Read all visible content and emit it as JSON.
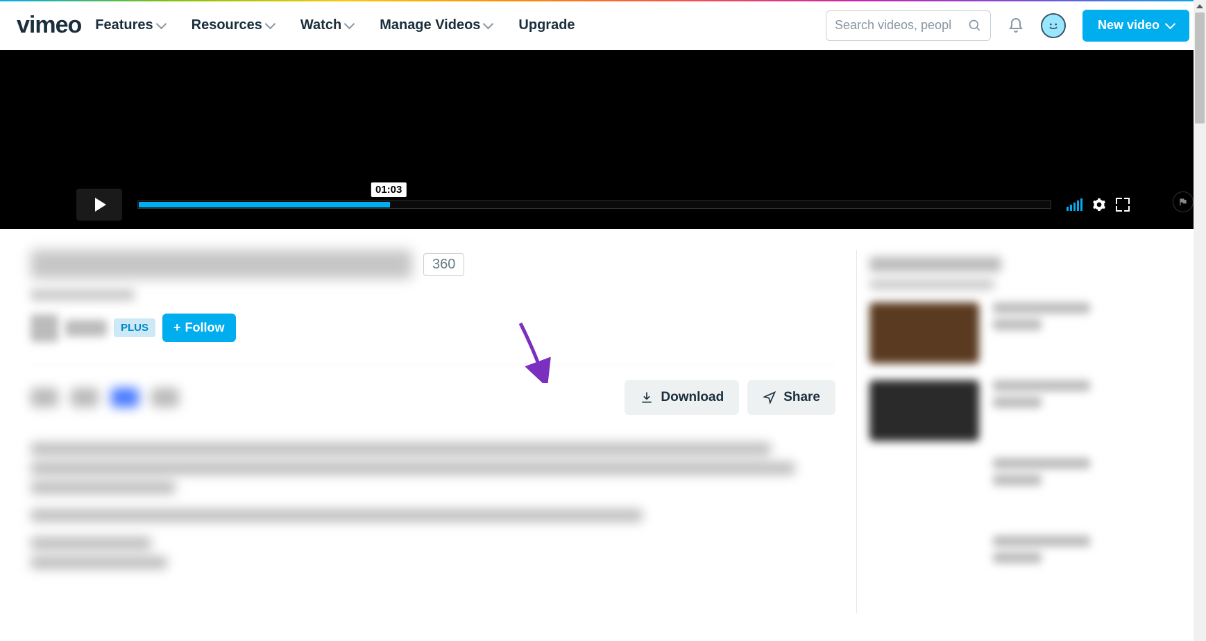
{
  "nav": {
    "features": "Features",
    "resources": "Resources",
    "watch": "Watch",
    "manage": "Manage Videos",
    "upgrade": "Upgrade"
  },
  "search": {
    "placeholder": "Search videos, peopl"
  },
  "new_video": "New video",
  "player": {
    "time_tooltip": "01:03",
    "progress_percent": 27.5
  },
  "video": {
    "badge": "360",
    "plus_tag": "PLUS",
    "follow": "Follow"
  },
  "actions": {
    "download": "Download",
    "share": "Share"
  },
  "colors": {
    "accent": "#00adef"
  }
}
